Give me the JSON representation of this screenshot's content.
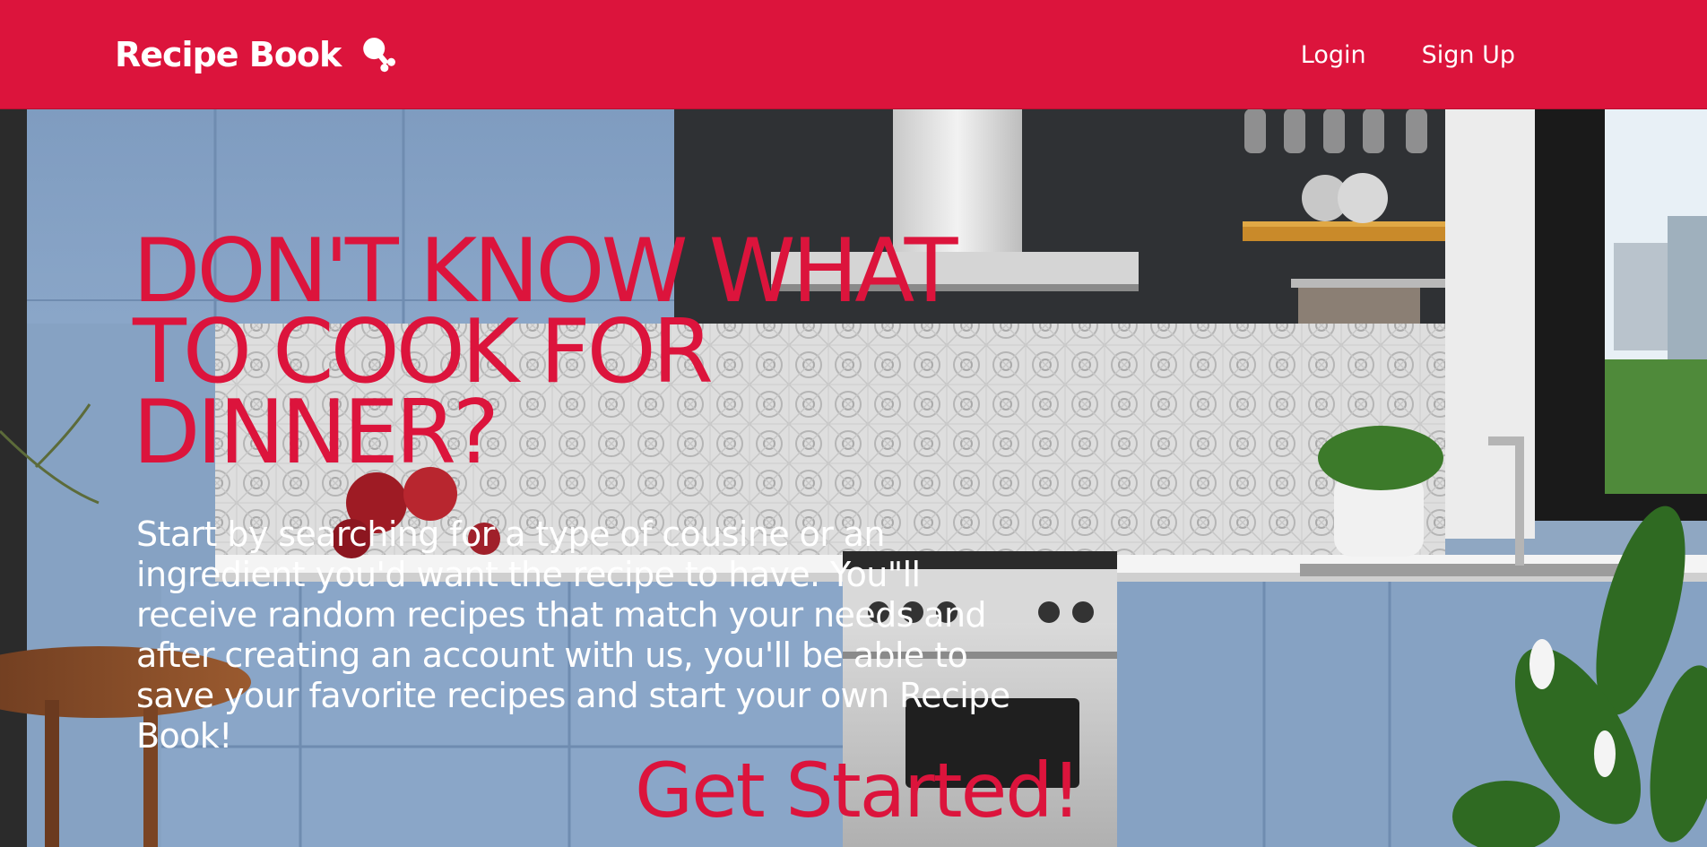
{
  "colors": {
    "brand": "#dc143c",
    "nav_text": "#ffffff",
    "hero_text": "#ffffff"
  },
  "navbar": {
    "brand_label": "Recipe Book",
    "brand_icon": "drumstick-icon",
    "links": [
      {
        "label": "Login"
      },
      {
        "label": "Sign Up"
      }
    ]
  },
  "hero": {
    "background": "kitchen-photo",
    "headline": "DON'T KNOW WHAT TO COOK FOR DINNER?",
    "description": "Start by searching for a type of cousine or an ingredient you'd want the recipe to have. You\"ll receive random recipes that match your needs and after creating an account with us, you'll be able to save your favorite recipes and start your own Recipe Book!",
    "cta_label": "Get Started!"
  }
}
